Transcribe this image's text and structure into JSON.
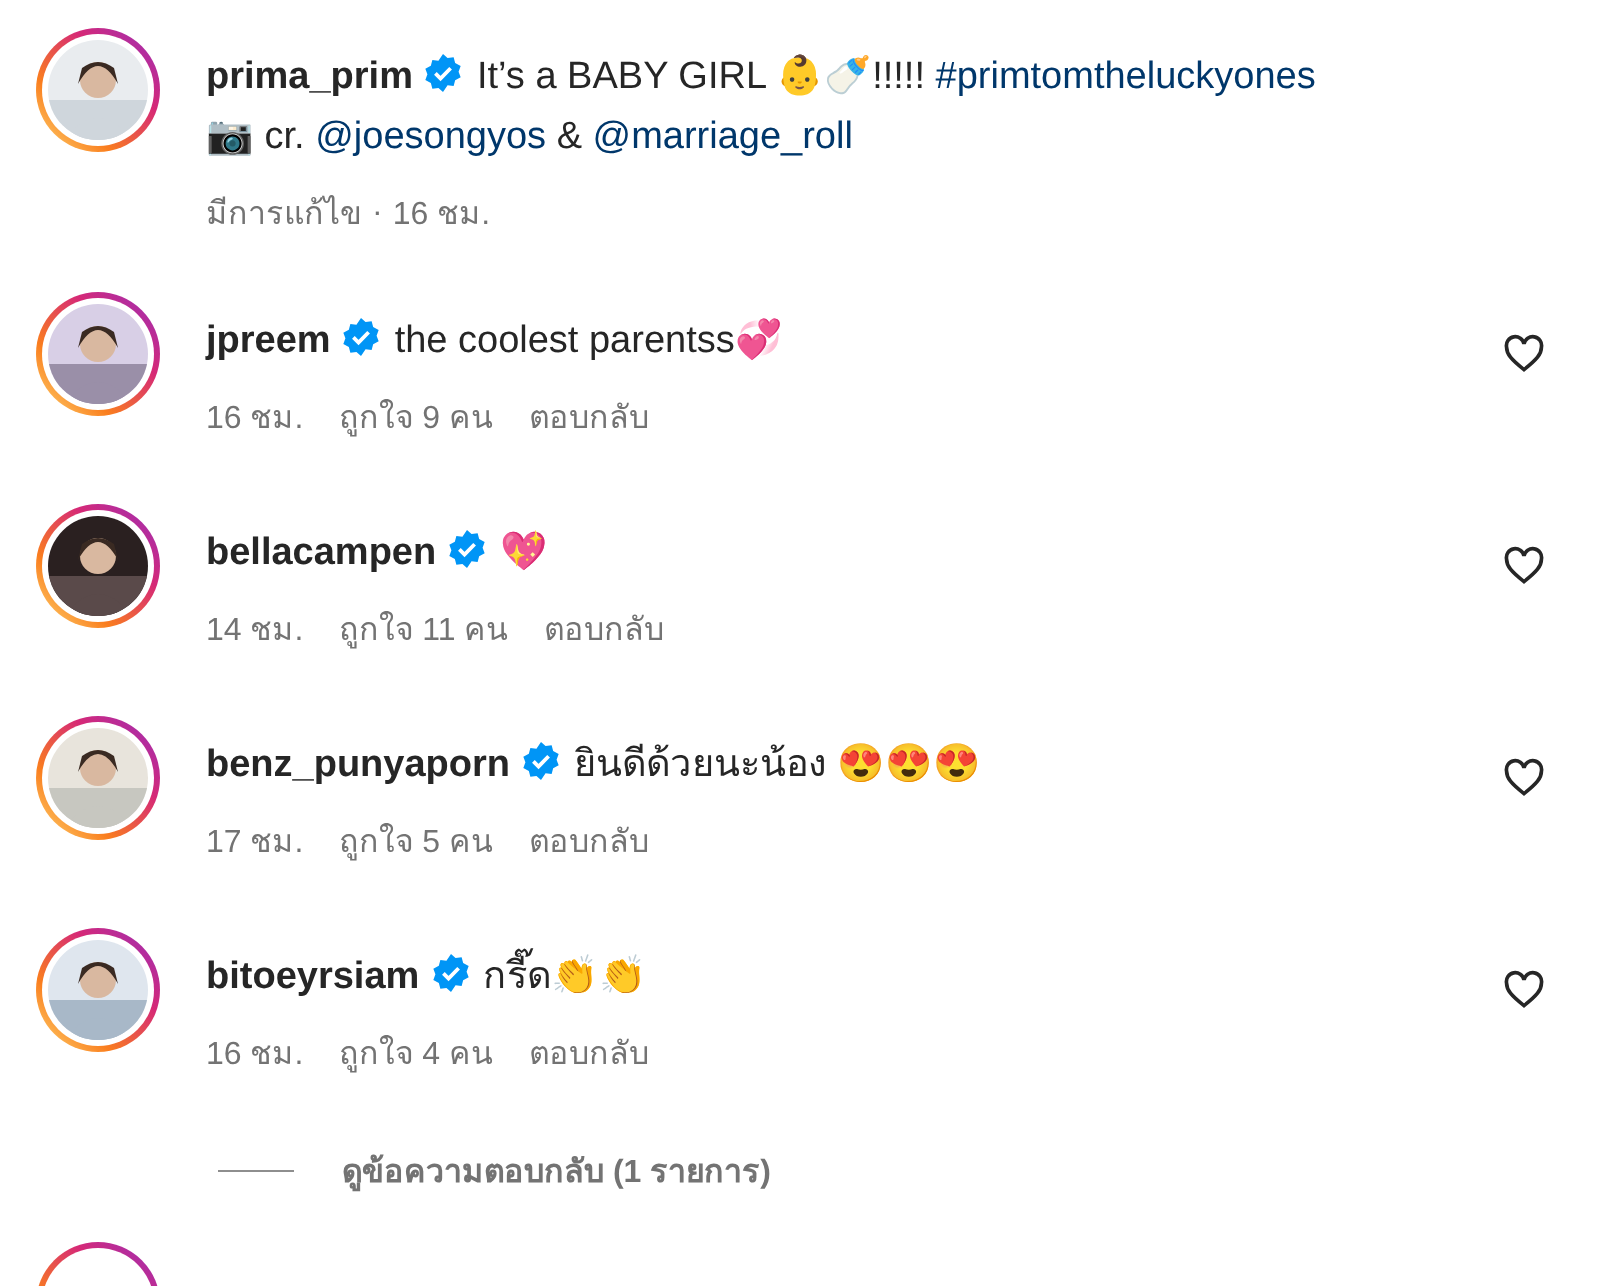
{
  "post": {
    "username": "prima_prim",
    "verified": true,
    "caption": [
      [
        {
          "kind": "text",
          "text": "It’s a BABY GIRL 👶🍼!!!!! "
        },
        {
          "kind": "link",
          "text": "#primtomtheluckyones"
        }
      ],
      [
        {
          "kind": "text",
          "text": "📷 cr. "
        },
        {
          "kind": "link",
          "text": "@joesongyos"
        },
        {
          "kind": "text",
          "text": " & "
        },
        {
          "kind": "link",
          "text": "@marriage_roll"
        }
      ]
    ],
    "edited": "มีการแก้ไข",
    "separator": "·",
    "time": "16 ชม."
  },
  "comments": [
    {
      "username": "jpreem",
      "verified": true,
      "text": "the coolest parentss💞",
      "time": "16 ชม.",
      "likes": "ถูกใจ 9 คน",
      "reply": "ตอบกลับ",
      "liked": false
    },
    {
      "username": "bellacampen",
      "verified": true,
      "text": "💖",
      "time": "14 ชม.",
      "likes": "ถูกใจ 11 คน",
      "reply": "ตอบกลับ",
      "liked": false
    },
    {
      "username": "benz_punyaporn",
      "verified": true,
      "text": "ยินดีด้วยนะน้อง 😍😍😍",
      "time": "17 ชม.",
      "likes": "ถูกใจ 5 คน",
      "reply": "ตอบกลับ",
      "liked": false
    },
    {
      "username": "bitoeyrsiam",
      "verified": true,
      "text": "กรี๊ด👏👏",
      "time": "16 ชม.",
      "likes": "ถูกใจ 4 คน",
      "reply": "ตอบกลับ",
      "liked": false,
      "view_replies": "ดูข้อความตอบกลับ (1 รายการ)"
    }
  ]
}
